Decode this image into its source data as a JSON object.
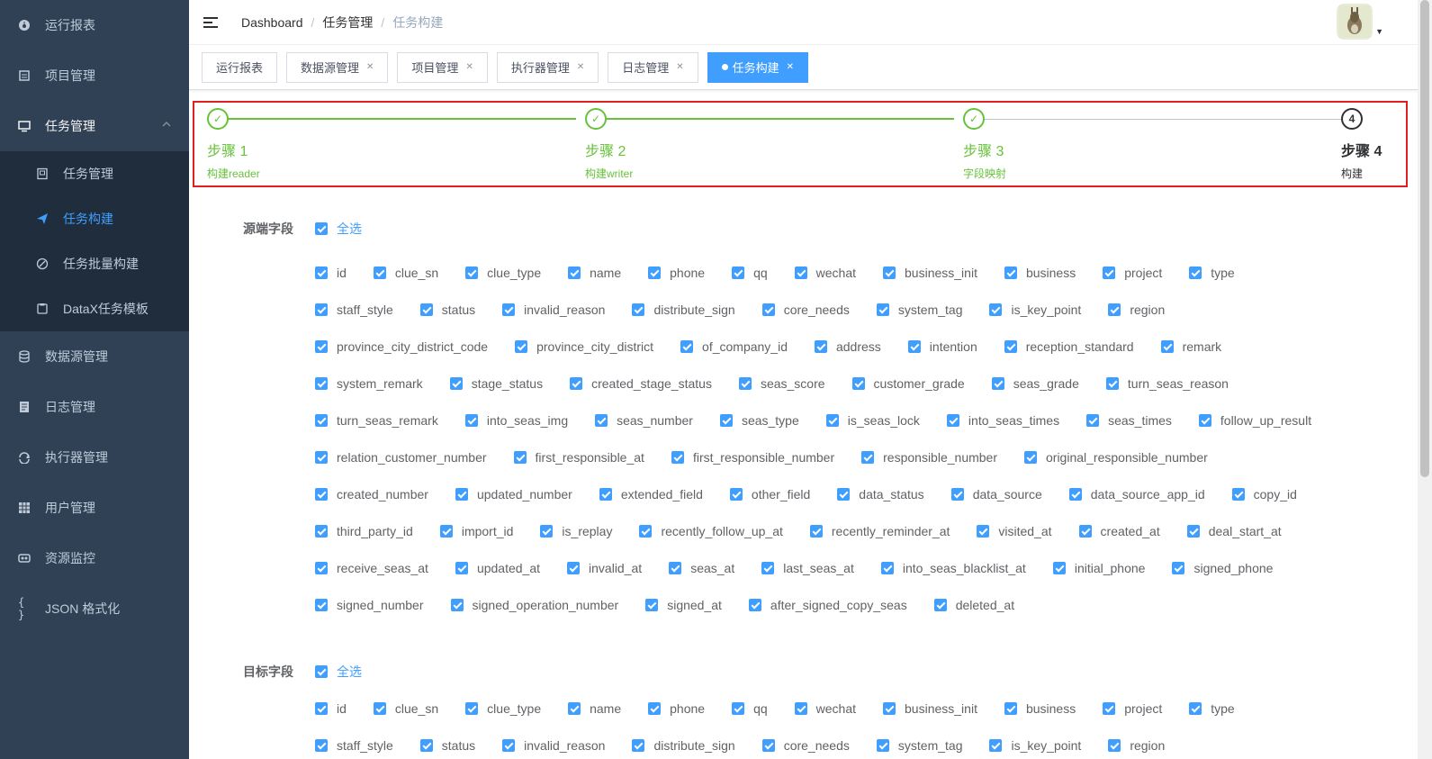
{
  "sidebar": {
    "items": [
      {
        "label": "运行报表",
        "icon": "dashboard-icon"
      },
      {
        "label": "项目管理",
        "icon": "project-icon"
      },
      {
        "label": "任务管理",
        "icon": "monitor-icon",
        "open": true
      },
      {
        "label": "数据源管理",
        "icon": "database-icon"
      },
      {
        "label": "日志管理",
        "icon": "log-icon"
      },
      {
        "label": "执行器管理",
        "icon": "executor-icon"
      },
      {
        "label": "用户管理",
        "icon": "user-table-icon"
      },
      {
        "label": "资源监控",
        "icon": "monitor-link-icon"
      },
      {
        "label": "JSON 格式化",
        "icon": "braces-icon"
      }
    ],
    "sub_items": [
      {
        "label": "任务管理",
        "icon": "task-list-icon"
      },
      {
        "label": "任务构建",
        "icon": "paper-plane-icon",
        "active": true
      },
      {
        "label": "任务批量构建",
        "icon": "batch-icon"
      },
      {
        "label": "DataX任务模板",
        "icon": "template-icon"
      }
    ]
  },
  "breadcrumb": [
    "Dashboard",
    "任务管理",
    "任务构建"
  ],
  "tags": [
    {
      "label": "运行报表",
      "closable": false
    },
    {
      "label": "数据源管理",
      "closable": true
    },
    {
      "label": "项目管理",
      "closable": true
    },
    {
      "label": "执行器管理",
      "closable": true
    },
    {
      "label": "日志管理",
      "closable": true
    },
    {
      "label": "任务构建",
      "closable": true,
      "active": true
    }
  ],
  "steps": [
    {
      "num": "1",
      "title": "步骤 1",
      "desc": "构建reader",
      "status": "finish"
    },
    {
      "num": "2",
      "title": "步骤 2",
      "desc": "构建writer",
      "status": "finish"
    },
    {
      "num": "3",
      "title": "步骤 3",
      "desc": "字段映射",
      "status": "finish"
    },
    {
      "num": "4",
      "title": "步骤 4",
      "desc": "构建",
      "status": "process"
    }
  ],
  "source": {
    "label": "源端字段",
    "check_all": "全选",
    "rows": [
      [
        "id",
        "clue_sn",
        "clue_type",
        "name",
        "phone",
        "qq",
        "wechat",
        "business_init",
        "business",
        "project",
        "type"
      ],
      [
        "staff_style",
        "status",
        "invalid_reason",
        "distribute_sign",
        "core_needs",
        "system_tag",
        "is_key_point",
        "region"
      ],
      [
        "province_city_district_code",
        "province_city_district",
        "of_company_id",
        "address",
        "intention",
        "reception_standard",
        "remark"
      ],
      [
        "system_remark",
        "stage_status",
        "created_stage_status",
        "seas_score",
        "customer_grade",
        "seas_grade",
        "turn_seas_reason"
      ],
      [
        "turn_seas_remark",
        "into_seas_img",
        "seas_number",
        "seas_type",
        "is_seas_lock",
        "into_seas_times",
        "seas_times",
        "follow_up_result"
      ],
      [
        "relation_customer_number",
        "first_responsible_at",
        "first_responsible_number",
        "responsible_number",
        "original_responsible_number"
      ],
      [
        "created_number",
        "updated_number",
        "extended_field",
        "other_field",
        "data_status",
        "data_source",
        "data_source_app_id",
        "copy_id"
      ],
      [
        "third_party_id",
        "import_id",
        "is_replay",
        "recently_follow_up_at",
        "recently_reminder_at",
        "visited_at",
        "created_at",
        "deal_start_at"
      ],
      [
        "receive_seas_at",
        "updated_at",
        "invalid_at",
        "seas_at",
        "last_seas_at",
        "into_seas_blacklist_at",
        "initial_phone",
        "signed_phone"
      ],
      [
        "signed_number",
        "signed_operation_number",
        "signed_at",
        "after_signed_copy_seas",
        "deleted_at"
      ]
    ]
  },
  "target": {
    "label": "目标字段",
    "check_all": "全选",
    "rows": [
      [
        "id",
        "clue_sn",
        "clue_type",
        "name",
        "phone",
        "qq",
        "wechat",
        "business_init",
        "business",
        "project",
        "type"
      ],
      [
        "staff_style",
        "status",
        "invalid_reason",
        "distribute_sign",
        "core_needs",
        "system_tag",
        "is_key_point",
        "region"
      ]
    ]
  },
  "colors": {
    "primary": "#409eff",
    "success": "#67c23a",
    "sidebar": "#304156",
    "highlight_border": "#e02020"
  }
}
